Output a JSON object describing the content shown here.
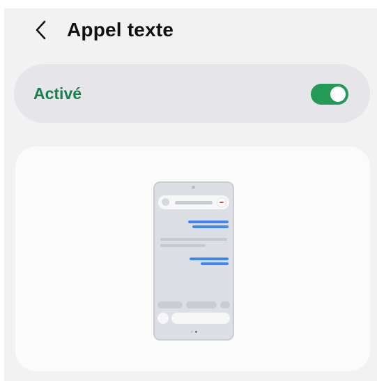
{
  "header": {
    "title": "Appel texte",
    "back_icon": "chevron-left-icon"
  },
  "toggle": {
    "label": "Activé",
    "state": "on",
    "accent_color": "#239a56",
    "label_color": "#1a7f4b"
  },
  "illustration": {
    "description_icon": "phone-text-call-icon",
    "end_call_icon": "end-call-icon"
  },
  "colors": {
    "background": "#f2f2f2",
    "card": "#fbfbfb",
    "toggle_row": "#e5e5ea",
    "message_blue": "#3f86f0"
  }
}
